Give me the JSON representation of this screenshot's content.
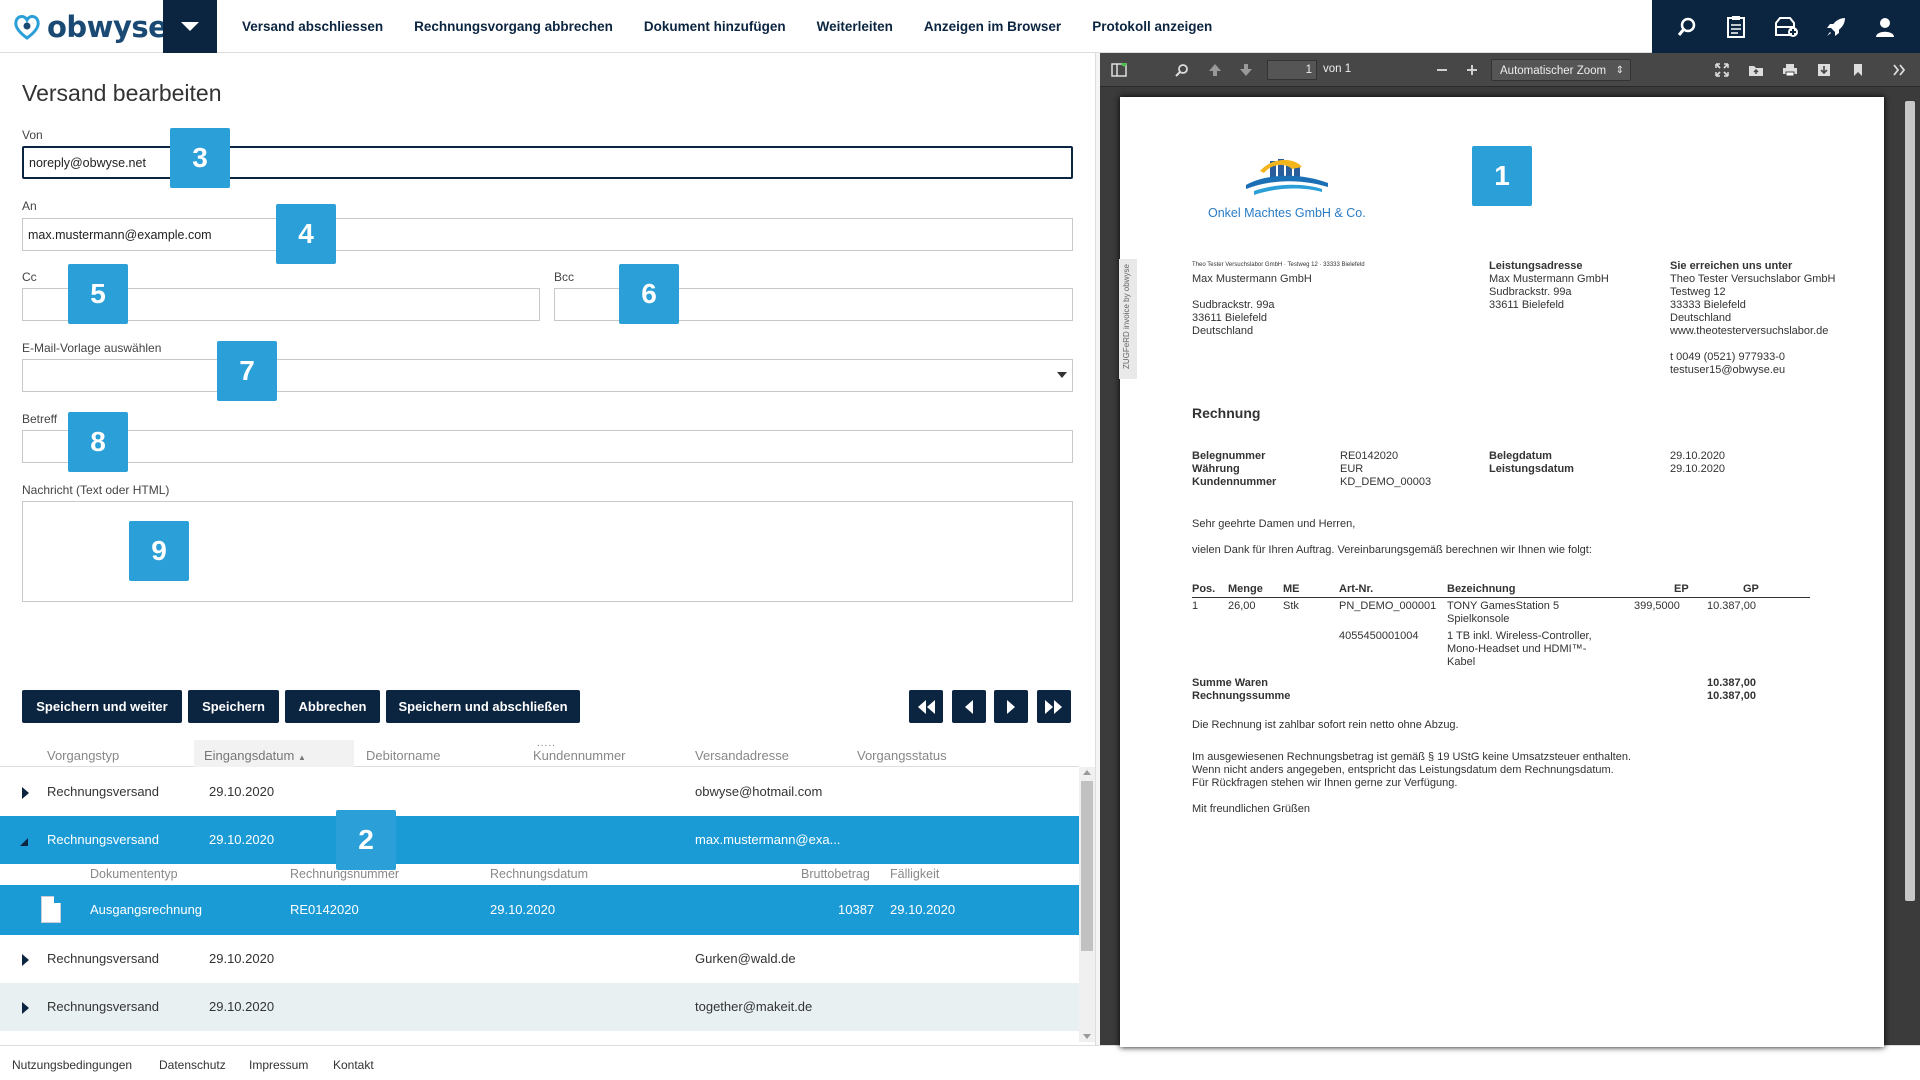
{
  "brand": {
    "name": "obwyse"
  },
  "nav": {
    "items": [
      "Versand abschliessen",
      "Rechnungsvorgang abbrechen",
      "Dokument hinzufügen",
      "Weiterleiten",
      "Anzeigen im Browser",
      "Protokoll anzeigen"
    ]
  },
  "toolbar_icons": [
    "search-icon",
    "clipboard-icon",
    "inbox-add-icon",
    "rocket-icon",
    "user-icon"
  ],
  "form": {
    "title": "Versand bearbeiten",
    "von_label": "Von",
    "von_value": "noreply@obwyse.net",
    "an_label": "An",
    "an_value": "max.mustermann@example.com",
    "cc_label": "Cc",
    "cc_value": "",
    "bcc_label": "Bcc",
    "bcc_value": "",
    "template_label": "E-Mail-Vorlage auswählen",
    "template_value": "",
    "betreff_label": "Betreff",
    "betreff_value": "",
    "nachricht_label": "Nachricht (Text oder HTML)",
    "nachricht_value": ""
  },
  "badges": [
    "1",
    "2",
    "3",
    "4",
    "5",
    "6",
    "7",
    "8",
    "9"
  ],
  "buttons": {
    "save_next": "Speichern und weiter",
    "save": "Speichern",
    "cancel": "Abbrechen",
    "save_close": "Speichern und abschließen"
  },
  "grid": {
    "columns": [
      "Vorgangstyp",
      "Eingangsdatum",
      "Debitorname",
      "Kundennummer",
      "Versandadresse",
      "Vorgangsstatus"
    ],
    "sort_indicator": "▲",
    "drag_handle": ".....",
    "rows": [
      {
        "typ": "Rechnungsversand",
        "datum": "29.10.2020",
        "adresse": "obwyse@hotmail.com"
      },
      {
        "typ": "Rechnungsversand",
        "datum": "29.10.2020",
        "adresse": "max.mustermann@exa..."
      },
      {
        "typ": "Rechnungsversand",
        "datum": "29.10.2020",
        "adresse": "Gurken@wald.de"
      },
      {
        "typ": "Rechnungsversand",
        "datum": "29.10.2020",
        "adresse": "together@makeit.de"
      }
    ],
    "sub_columns": [
      "Dokumententyp",
      "Rechnungsnummer",
      "Rechnungsdatum",
      "Bruttobetrag",
      "Fälligkeit"
    ],
    "sub_row": {
      "typ": "Ausgangsrechnung",
      "nummer": "RE0142020",
      "datum": "29.10.2020",
      "betrag": "10387",
      "faellig": "29.10.2020"
    }
  },
  "footer": {
    "links": [
      "Nutzungsbedingungen",
      "Datenschutz",
      "Impressum",
      "Kontakt"
    ]
  },
  "viewer": {
    "page_value": "1",
    "page_count": "von 1",
    "zoom": "Automatischer Zoom",
    "zoom_caret": "⇕"
  },
  "invoice": {
    "company": "Onkel Machtes GmbH & Co.",
    "sender_line": "Theo Tester Versuchslabor GmbH · Testweg 12 · 33333 Bielefeld",
    "recipient": [
      "Max Mustermann GmbH",
      "",
      "Sudbrackstr. 99a",
      "33611 Bielefeld",
      "Deutschland"
    ],
    "leistung_title": "Leistungsadresse",
    "leistung": [
      "Max Mustermann GmbH",
      "Sudbrackstr. 99a",
      "33611 Bielefeld"
    ],
    "contact_title": "Sie erreichen uns unter",
    "contact": [
      "Theo Tester Versuchslabor GmbH",
      "Testweg 12",
      "33333 Bielefeld",
      "Deutschland",
      "www.theotesterversuchslabor.de",
      "",
      "t  0049  (0521)  977933-0",
      "testuser15@obwyse.eu"
    ],
    "sidetab": "ZUGFeRD invoice by obwyse",
    "heading": "Rechnung",
    "meta_labels": [
      "Belegnummer",
      "Währung",
      "Kundennummer"
    ],
    "meta_values": [
      "RE0142020",
      "EUR",
      "KD_DEMO_00003"
    ],
    "meta2_labels": [
      "Belegdatum",
      "Leistungsdatum"
    ],
    "meta2_values": [
      "29.10.2020",
      "29.10.2020"
    ],
    "greeting": "Sehr geehrte Damen und Herren,",
    "intro": "vielen Dank für Ihren Auftrag. Vereinbarungsgemäß berechnen wir Ihnen wie folgt:",
    "table_head": [
      "Pos.",
      "Menge",
      "ME",
      "Art-Nr.",
      "Bezeichnung",
      "EP",
      "GP"
    ],
    "line": {
      "pos": "1",
      "menge": "26,00",
      "me": "Stk",
      "art": "PN_DEMO_000001",
      "bez1": "TONY GamesStation 5",
      "bez2": "Spielkonsole",
      "ep": "399,5000",
      "gp": "10.387,00",
      "art2": "4055450001004",
      "bez3": "1 TB inkl. Wireless-Controller,",
      "bez4": "Mono-Headset und HDMI™-",
      "bez5": "Kabel"
    },
    "sum_labels": [
      "Summe Waren",
      "Rechnungssumme"
    ],
    "sum_values": [
      "10.387,00",
      "10.387,00"
    ],
    "payment": "Die Rechnung ist zahlbar sofort rein netto ohne Abzug.",
    "tax": [
      "Im ausgewiesenen Rechnungsbetrag ist gemäß § 19 UStG keine Umsatzsteuer enthalten.",
      "Wenn nicht anders angegeben, entspricht das Leistungsdatum dem Rechnungsdatum.",
      "Für Rückfragen stehen wir Ihnen gerne zur Verfügung."
    ],
    "closing": "Mit freundlichen Grüßen"
  }
}
